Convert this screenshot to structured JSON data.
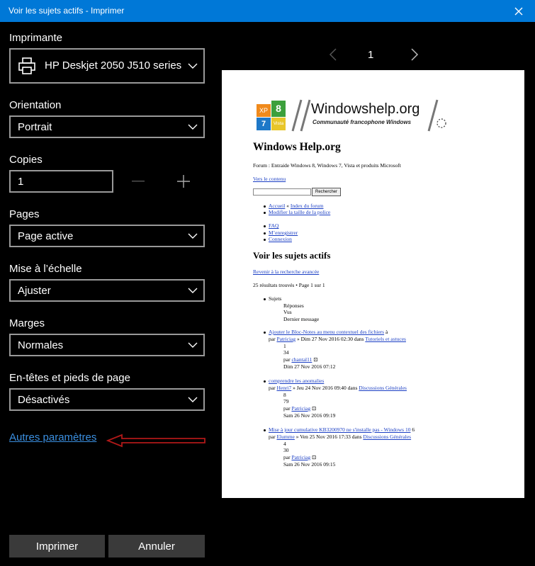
{
  "window": {
    "title": "Voir les sujets actifs - Imprimer"
  },
  "settings": {
    "printer_label": "Imprimante",
    "printer_value": "HP Deskjet 2050 J510 series",
    "orientation_label": "Orientation",
    "orientation_value": "Portrait",
    "copies_label": "Copies",
    "copies_value": "1",
    "pages_label": "Pages",
    "pages_value": "Page active",
    "scale_label": "Mise à l’échelle",
    "scale_value": "Ajuster",
    "margins_label": "Marges",
    "margins_value": "Normales",
    "headers_label": "En-têtes et pieds de page",
    "headers_value": "Désactivés",
    "more_settings": "Autres paramètres"
  },
  "buttons": {
    "print": "Imprimer",
    "cancel": "Annuler"
  },
  "preview": {
    "page_number": "1",
    "logo": {
      "tiles": [
        "XP",
        "8",
        "7",
        "Vista"
      ],
      "site_name": "Windowshelp.org",
      "tagline": "Communauté francophone Windows"
    },
    "site_title": "Windows Help.org",
    "forum_desc": "Forum : Entraide Windows 8, Windows 7, Vista et produits Microsoft",
    "skip_link": "Vers le contenu",
    "search_button": "Rechercher",
    "nav_links": [
      {
        "a": "Accueil",
        "sep": " « ",
        "b": "Index du forum"
      },
      {
        "a": "Modifier la taille de la police"
      }
    ],
    "user_links": [
      "FAQ",
      "M’enregistrer",
      "Connexion"
    ],
    "section_title": "Voir les sujets actifs",
    "back_link": "Revenir à la recherche avancée",
    "results": "25 résultats trouvés • Page 1 sur 1",
    "columns": [
      "Sujets",
      "Réponses",
      "Vus",
      "Dernier message"
    ],
    "topics": [
      {
        "title": "Ajouter le Bloc-Notes au menu contextuel des fichiers",
        "suffix": " à",
        "author_prefix": "par ",
        "author": "Patriciag",
        "date": " » Dim 27 Nov 2016 02:30 dans ",
        "forum": "Tutoriels et astuces",
        "replies": "1",
        "views": "34",
        "last_by": "chantal11",
        "last_date": "Dim 27 Nov 2016 07:12"
      },
      {
        "title": "comprendre les anomalies",
        "suffix": "",
        "author_prefix": "par ",
        "author": "Henri7",
        "date": " » Jeu 24 Nov 2016 09:40 dans ",
        "forum": "Discussions Générales",
        "replies": "8",
        "views": "79",
        "last_by": "Patriciag",
        "last_date": "Sam 26 Nov 2016 09:19"
      },
      {
        "title": "Mise à jour cumulative KB3200970 ne s'installe pas - Windows 10",
        "suffix": " 6",
        "author_prefix": "par ",
        "author": "Elumme",
        "date": " » Ven 25 Nov 2016 17:33 dans ",
        "forum": "Discussions Générales",
        "replies": "4",
        "views": "30",
        "last_by": "Patriciag",
        "last_date": "Sam 26 Nov 2016 09:15"
      }
    ],
    "last_prefix": "par "
  },
  "colors": {
    "titlebar": "#0078d7",
    "link": "#3b8fe0",
    "annotation_arrow": "#b01818"
  }
}
